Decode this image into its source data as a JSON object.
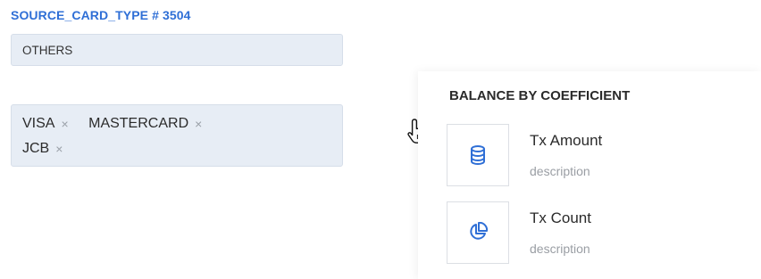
{
  "section": {
    "label": "SOURCE_CARD_TYPE # 3504"
  },
  "single_select": {
    "value": "OTHERS"
  },
  "multi_select": {
    "tags": [
      {
        "label": "VISA",
        "remove": "×"
      },
      {
        "label": "MASTERCARD",
        "remove": "×"
      },
      {
        "label": "JCB",
        "remove": "×"
      }
    ]
  },
  "panel": {
    "title": "BALANCE BY COEFFICIENT",
    "items": [
      {
        "title": "Tx Amount",
        "description": "description",
        "icon": "database-icon"
      },
      {
        "title": "Tx Count",
        "description": "description",
        "icon": "pie-chart-icon"
      }
    ]
  },
  "colors": {
    "accent": "#2f6fd6",
    "input_bg": "#e7edf5",
    "icon_blue": "#2f6fd6"
  },
  "cursor": {
    "icon": "hand-pointer-icon"
  }
}
